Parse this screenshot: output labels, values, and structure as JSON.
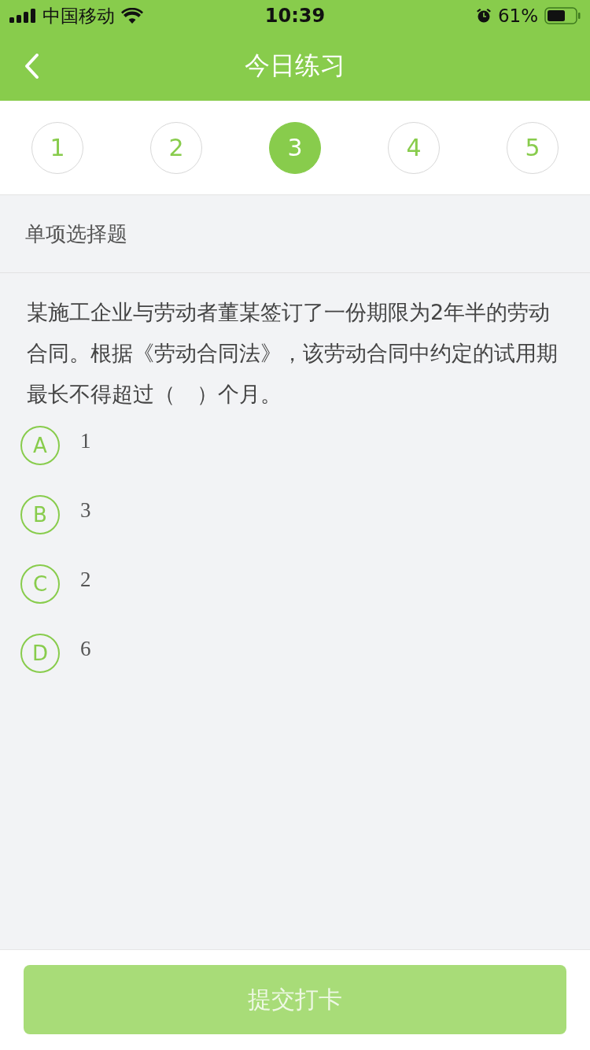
{
  "status_bar": {
    "carrier": "中国移动",
    "time": "10:39",
    "battery": "61%"
  },
  "nav": {
    "title": "今日练习"
  },
  "steps": [
    {
      "label": "1",
      "selected": false
    },
    {
      "label": "2",
      "selected": false
    },
    {
      "label": "3",
      "selected": true
    },
    {
      "label": "4",
      "selected": false
    },
    {
      "label": "5",
      "selected": false
    }
  ],
  "question_type": "单项选择题",
  "question": "某施工企业与劳动者董某签订了一份期限为2年半的劳动合同。根据《劳动合同法》，该劳动合同中约定的试用期最长不得超过（　）个月。",
  "options": [
    {
      "letter": "A",
      "text": "1",
      "selected": false
    },
    {
      "letter": "B",
      "text": "3",
      "selected": false
    },
    {
      "letter": "C",
      "text": "2",
      "selected": false
    },
    {
      "letter": "D",
      "text": "6",
      "selected": false
    }
  ],
  "submit": {
    "label": "提交打卡",
    "disabled": true
  }
}
